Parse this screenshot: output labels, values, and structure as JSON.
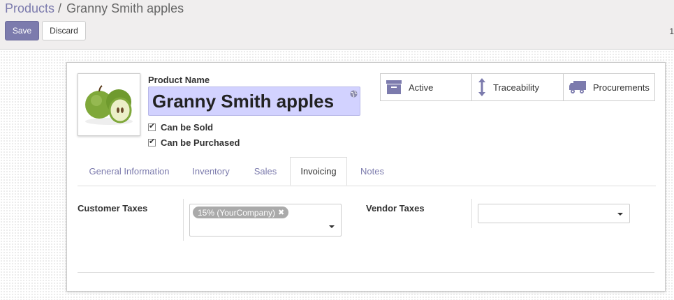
{
  "breadcrumb": {
    "parent": "Products",
    "separator": "/",
    "current": "Granny Smith apples"
  },
  "toolbar": {
    "save_label": "Save",
    "discard_label": "Discard",
    "pager_text": "1"
  },
  "product": {
    "name_label": "Product Name",
    "name": "Granny Smith apples",
    "can_be_sold_label": "Can be Sold",
    "can_be_sold": true,
    "can_be_purchased_label": "Can be Purchased",
    "can_be_purchased": true
  },
  "smart_buttons": [
    {
      "label": "Active",
      "icon": "archive-icon"
    },
    {
      "label": "Traceability",
      "icon": "arrows-vertical-icon"
    },
    {
      "label": "Procurements",
      "icon": "truck-icon"
    }
  ],
  "tabs": [
    {
      "label": "General Information",
      "active": false
    },
    {
      "label": "Inventory",
      "active": false
    },
    {
      "label": "Sales",
      "active": false
    },
    {
      "label": "Invoicing",
      "active": true
    },
    {
      "label": "Notes",
      "active": false
    }
  ],
  "invoicing": {
    "customer_taxes_label": "Customer Taxes",
    "customer_taxes_tags": [
      "15% (YourCompany)"
    ],
    "vendor_taxes_label": "Vendor Taxes",
    "vendor_taxes_value": ""
  },
  "colors": {
    "brand": "#7c7bad",
    "name_highlight": "#d2d2ff",
    "tag_bg": "#aaaaaa"
  }
}
